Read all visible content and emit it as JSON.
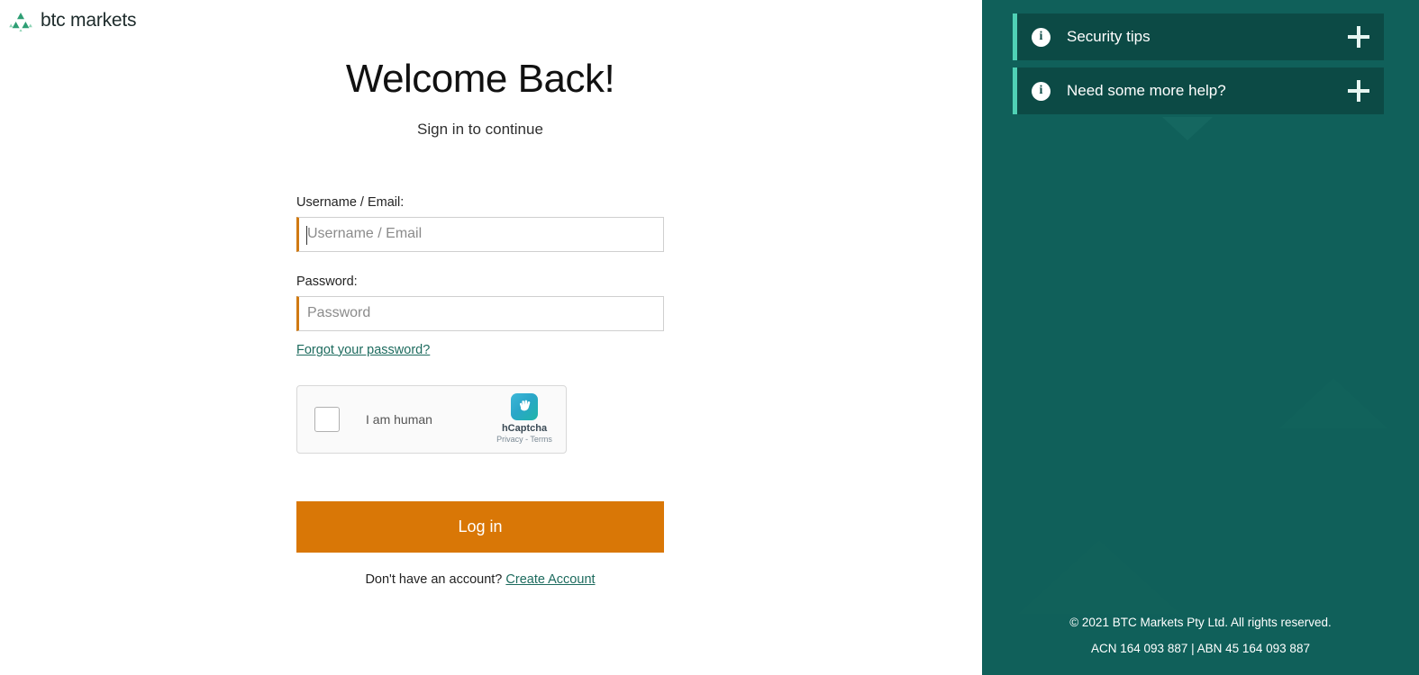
{
  "brand": {
    "name": "btc markets",
    "logo_icon": "triangle-pyramid-icon",
    "logo_color": "#2e9e74"
  },
  "login": {
    "headline": "Welcome Back!",
    "subhead": "Sign in to continue",
    "username": {
      "label": "Username / Email:",
      "placeholder": "Username / Email",
      "value": "",
      "focused": true,
      "accent_color": "#d07a12"
    },
    "password": {
      "label": "Password:",
      "placeholder": "Password",
      "value": "",
      "accent_color": "#d07a12"
    },
    "forgot_link": "Forgot your password?",
    "submit_label": "Log in",
    "submit_color": "#d97706",
    "signup_prompt": "Don't have an account?",
    "signup_link": "Create Account",
    "link_color": "#1d6b5e"
  },
  "captcha": {
    "checkbox_label": "I am human",
    "checked": false,
    "brand_name": "hCaptcha",
    "legal": "Privacy - Terms",
    "logo_icon": "hcaptcha-hand-icon"
  },
  "sidebar": {
    "background_color": "#10605a",
    "accent_color": "#4fd1b5",
    "panel_color": "#0c4a45",
    "items": [
      {
        "label": "Security tips",
        "info_icon": "info-circle-icon",
        "toggle_icon": "plus-icon",
        "expanded": false
      },
      {
        "label": "Need some more help?",
        "info_icon": "info-circle-icon",
        "toggle_icon": "plus-icon",
        "expanded": false
      }
    ],
    "footer": {
      "copyright": "© 2021 BTC Markets Pty Ltd. All rights reserved.",
      "registration": "ACN 164 093 887 | ABN 45 164 093 887"
    }
  }
}
